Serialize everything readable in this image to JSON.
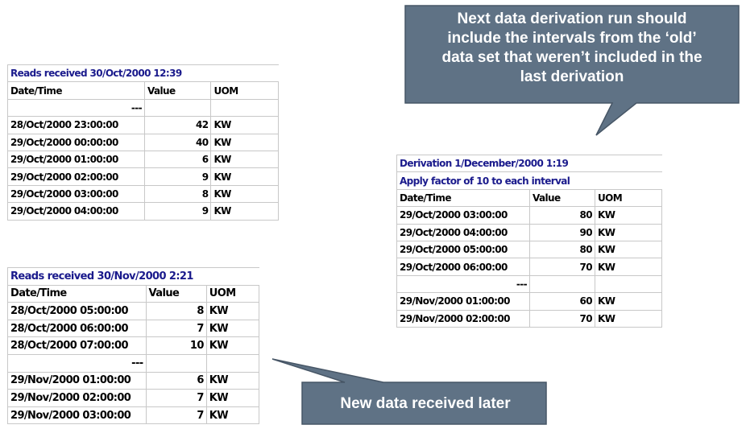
{
  "callouts": {
    "top": {
      "lines": [
        "Next data derivation run should",
        "include the intervals from the ‘old’",
        "data set that weren’t included in the",
        "last derivation"
      ]
    },
    "bottom": {
      "text": "New data received later"
    },
    "fill_color": "#5f7285"
  },
  "reads_oct": {
    "title": "Reads received 30/Oct/2000 12:39",
    "headers": [
      "Date/Time",
      "Value",
      "UOM"
    ],
    "ellipsis": "---",
    "rows": [
      {
        "datetime": "28/Oct/2000 23:00:00",
        "value": "42",
        "uom": "KW"
      },
      {
        "datetime": "29/Oct/2000 00:00:00",
        "value": "40",
        "uom": "KW"
      },
      {
        "datetime": "29/Oct/2000 01:00:00",
        "value": "6",
        "uom": "KW"
      },
      {
        "datetime": "29/Oct/2000 02:00:00",
        "value": "9",
        "uom": "KW"
      },
      {
        "datetime": "29/Oct/2000 03:00:00",
        "value": "8",
        "uom": "KW"
      },
      {
        "datetime": "29/Oct/2000 04:00:00",
        "value": "9",
        "uom": "KW"
      }
    ]
  },
  "derivation": {
    "title": "Derivation 1/December/2000 1:19",
    "subtitle": "Apply factor of 10 to each interval",
    "headers": [
      "Date/Time",
      "Value",
      "UOM"
    ],
    "ellipsis": "---",
    "rows_before": [
      {
        "datetime": "29/Oct/2000 03:00:00",
        "value": "80",
        "uom": "KW"
      },
      {
        "datetime": "29/Oct/2000 04:00:00",
        "value": "90",
        "uom": "KW"
      },
      {
        "datetime": "29/Oct/2000 05:00:00",
        "value": "80",
        "uom": "KW"
      },
      {
        "datetime": "29/Oct/2000 06:00:00",
        "value": "70",
        "uom": "KW"
      }
    ],
    "rows_after": [
      {
        "datetime": "29/Nov/2000 01:00:00",
        "value": "60",
        "uom": "KW"
      },
      {
        "datetime": "29/Nov/2000 02:00:00",
        "value": "70",
        "uom": "KW"
      }
    ]
  },
  "reads_nov": {
    "title": "Reads received 30/Nov/2000 2:21",
    "headers": [
      "Date/Time",
      "Value",
      "UOM"
    ],
    "ellipsis": "---",
    "rows_before": [
      {
        "datetime": "28/Oct/2000 05:00:00",
        "value": "8",
        "uom": "KW"
      },
      {
        "datetime": "28/Oct/2000 06:00:00",
        "value": "7",
        "uom": "KW"
      },
      {
        "datetime": "28/Oct/2000 07:00:00",
        "value": "10",
        "uom": "KW"
      }
    ],
    "rows_after": [
      {
        "datetime": "29/Nov/2000 01:00:00",
        "value": "6",
        "uom": "KW"
      },
      {
        "datetime": "29/Nov/2000 02:00:00",
        "value": "7",
        "uom": "KW"
      },
      {
        "datetime": "29/Nov/2000 03:00:00",
        "value": "7",
        "uom": "KW"
      }
    ]
  }
}
